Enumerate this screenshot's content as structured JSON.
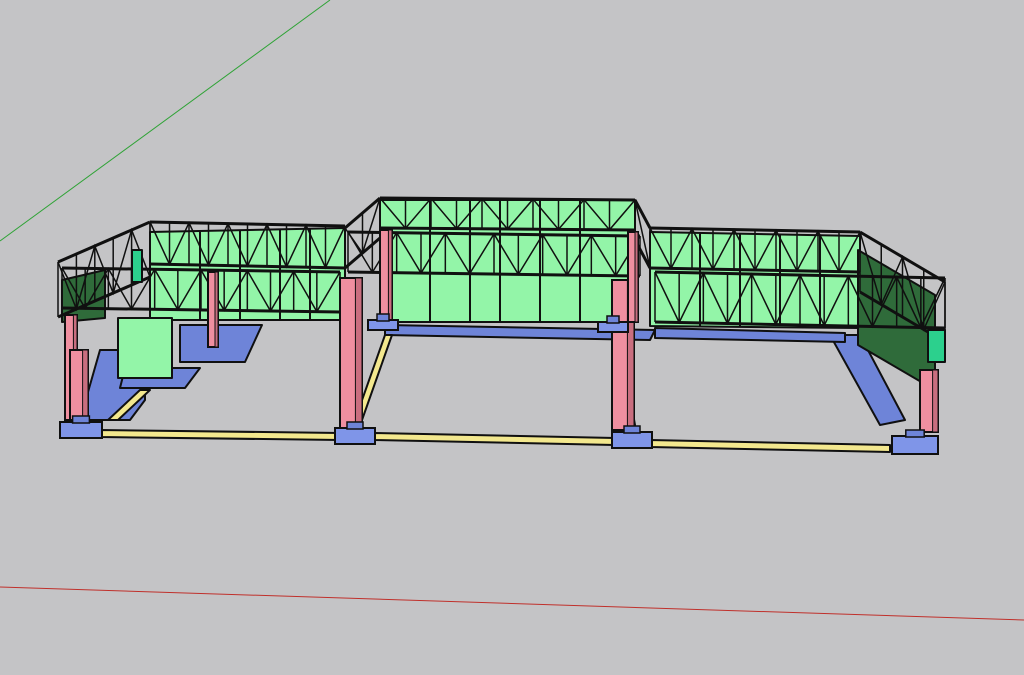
{
  "viewport": {
    "background": "#c4c4c6"
  },
  "axes": {
    "green_axis_color": "#2fa336",
    "red_axis_color": "#c0302b"
  },
  "materials": {
    "glass_panel": "#93f5a8",
    "glass_panel_dark": "#2f6b3a",
    "column": "#ef8fa0",
    "column_shade": "#c96e7f",
    "foundation": "#6e84d8",
    "footing": "#7f95e8",
    "tie_beam": "#f3e88e",
    "edge": "#101010",
    "cap": "#2cd08d"
  }
}
